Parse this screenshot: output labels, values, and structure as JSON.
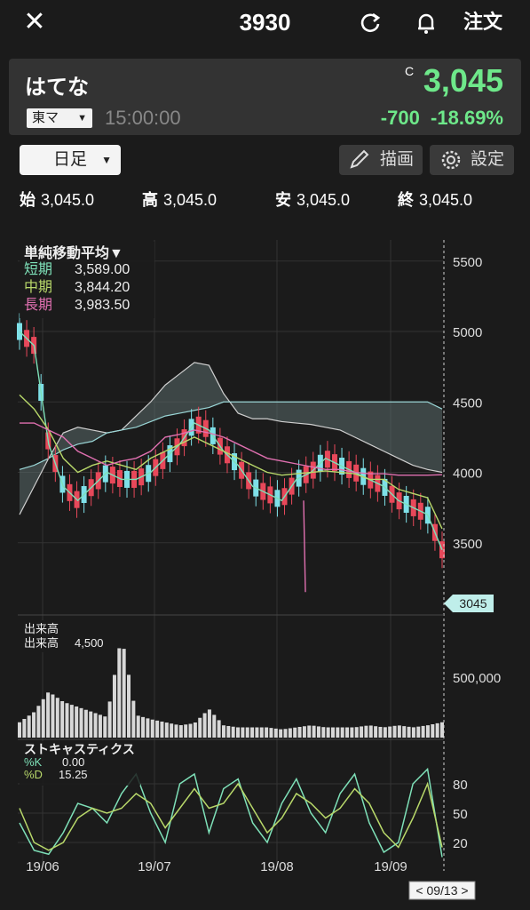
{
  "header": {
    "close_icon": "close-icon",
    "ticker": "3930",
    "refresh_icon": "refresh-icon",
    "bell_icon": "bell-icon",
    "order_label": "注文"
  },
  "quote": {
    "name": "はてな",
    "market": "東マ",
    "time": "15:00:00",
    "c_mark": "C",
    "price": "3,045",
    "change": "-700",
    "change_pct": "-18.69%",
    "color_down": "#6ee88a"
  },
  "controls": {
    "period": "日足",
    "draw_label": "描画",
    "settings_label": "設定"
  },
  "ohlc": [
    {
      "label": "始",
      "value": "3,045.0"
    },
    {
      "label": "高",
      "value": "3,045.0"
    },
    {
      "label": "安",
      "value": "3,045.0"
    },
    {
      "label": "終",
      "value": "3,045.0"
    }
  ],
  "ma_panel": {
    "title": "単純移動平均▼",
    "rows": [
      {
        "label": "短期",
        "value": "3,589.00",
        "color": "#7ee0b8"
      },
      {
        "label": "中期",
        "value": "3,844.20",
        "color": "#b8d86a"
      },
      {
        "label": "長期",
        "value": "3,983.50",
        "color": "#e070b0"
      }
    ]
  },
  "volume_panel": {
    "title": "出来高",
    "label": "出来高",
    "value": "4,500"
  },
  "stoch_panel": {
    "title": "ストキャスティクス",
    "k_label": "%K",
    "k_value": "0.00",
    "d_label": "%D",
    "d_value": "15.25"
  },
  "price_marker": "3045",
  "date_marker": "< 09/13 >",
  "chart_data": {
    "type": "candlestick",
    "price_axis": {
      "ticks": [
        "5500",
        "5000",
        "4500",
        "4000",
        "3500"
      ],
      "ylim": [
        3000,
        5650
      ]
    },
    "volume_axis": {
      "ticks": [
        "500,000"
      ]
    },
    "stoch_axis": {
      "ticks": [
        "80",
        "50",
        "20"
      ],
      "ylim": [
        0,
        100
      ]
    },
    "x_ticks": [
      "19/06",
      "19/07",
      "19/08",
      "19/09"
    ],
    "ichimoku_senkou_a": [
      3700,
      3900,
      4100,
      4280,
      4320,
      4300,
      4280,
      4300,
      4400,
      4500,
      4620,
      4700,
      4780,
      4760,
      4560,
      4420,
      4380,
      4380,
      4360,
      4350,
      4340,
      4320,
      4300,
      4250,
      4200,
      4150,
      4100,
      4050,
      4020,
      4000
    ],
    "ichimoku_senkou_b": [
      4020,
      4050,
      4100,
      4160,
      4200,
      4220,
      4280,
      4300,
      4320,
      4360,
      4400,
      4420,
      4440,
      4460,
      4500,
      4500,
      4500,
      4500,
      4500,
      4500,
      4500,
      4500,
      4500,
      4500,
      4500,
      4500,
      4500,
      4500,
      4500,
      4450
    ],
    "ma_short": [
      5000,
      4900,
      4200,
      3900,
      3800,
      3900,
      4000,
      3950,
      3950,
      4000,
      4100,
      4200,
      4350,
      4300,
      4150,
      4050,
      3900,
      3850,
      3800,
      3950,
      4000,
      4100,
      4050,
      4000,
      3950,
      3900,
      3800,
      3750,
      3700,
      3450
    ],
    "ma_medium": [
      4550,
      4450,
      4300,
      4100,
      4000,
      4050,
      4080,
      4050,
      4020,
      4100,
      4150,
      4200,
      4250,
      4200,
      4150,
      4100,
      4050,
      4000,
      3980,
      3990,
      4000,
      4010,
      4000,
      3990,
      3950,
      3950,
      3880,
      3850,
      3820,
      3600
    ],
    "ma_long": [
      4350,
      4350,
      4300,
      4250,
      4150,
      4100,
      4050,
      4080,
      4100,
      4150,
      4250,
      4270,
      4300,
      4280,
      4250,
      4200,
      4150,
      4100,
      4080,
      4060,
      4040,
      4020,
      4020,
      4000,
      3990,
      3990,
      3980,
      3980,
      3980,
      3983
    ],
    "ma_long_spike": [
      {
        "x": "19/08",
        "low": 3500
      }
    ],
    "volume": [
      0.15,
      0.25,
      0.45,
      0.35,
      0.3,
      0.25,
      0.2,
      1.0,
      0.22,
      0.18,
      0.15,
      0.12,
      0.14,
      0.28,
      0.12,
      0.1,
      0.1,
      0.1,
      0.08,
      0.1,
      0.12,
      0.1,
      0.1,
      0.1,
      0.12,
      0.1,
      0.12,
      0.1,
      0.12,
      0.15
    ],
    "stoch_k": [
      40,
      12,
      8,
      30,
      60,
      55,
      40,
      70,
      90,
      50,
      20,
      80,
      90,
      30,
      75,
      85,
      40,
      20,
      60,
      85,
      50,
      30,
      70,
      90,
      40,
      10,
      20,
      80,
      95,
      5
    ],
    "stoch_d": [
      55,
      20,
      12,
      20,
      45,
      55,
      50,
      55,
      70,
      60,
      35,
      55,
      75,
      55,
      60,
      80,
      55,
      30,
      45,
      70,
      60,
      45,
      55,
      75,
      60,
      30,
      15,
      45,
      80,
      15
    ]
  }
}
